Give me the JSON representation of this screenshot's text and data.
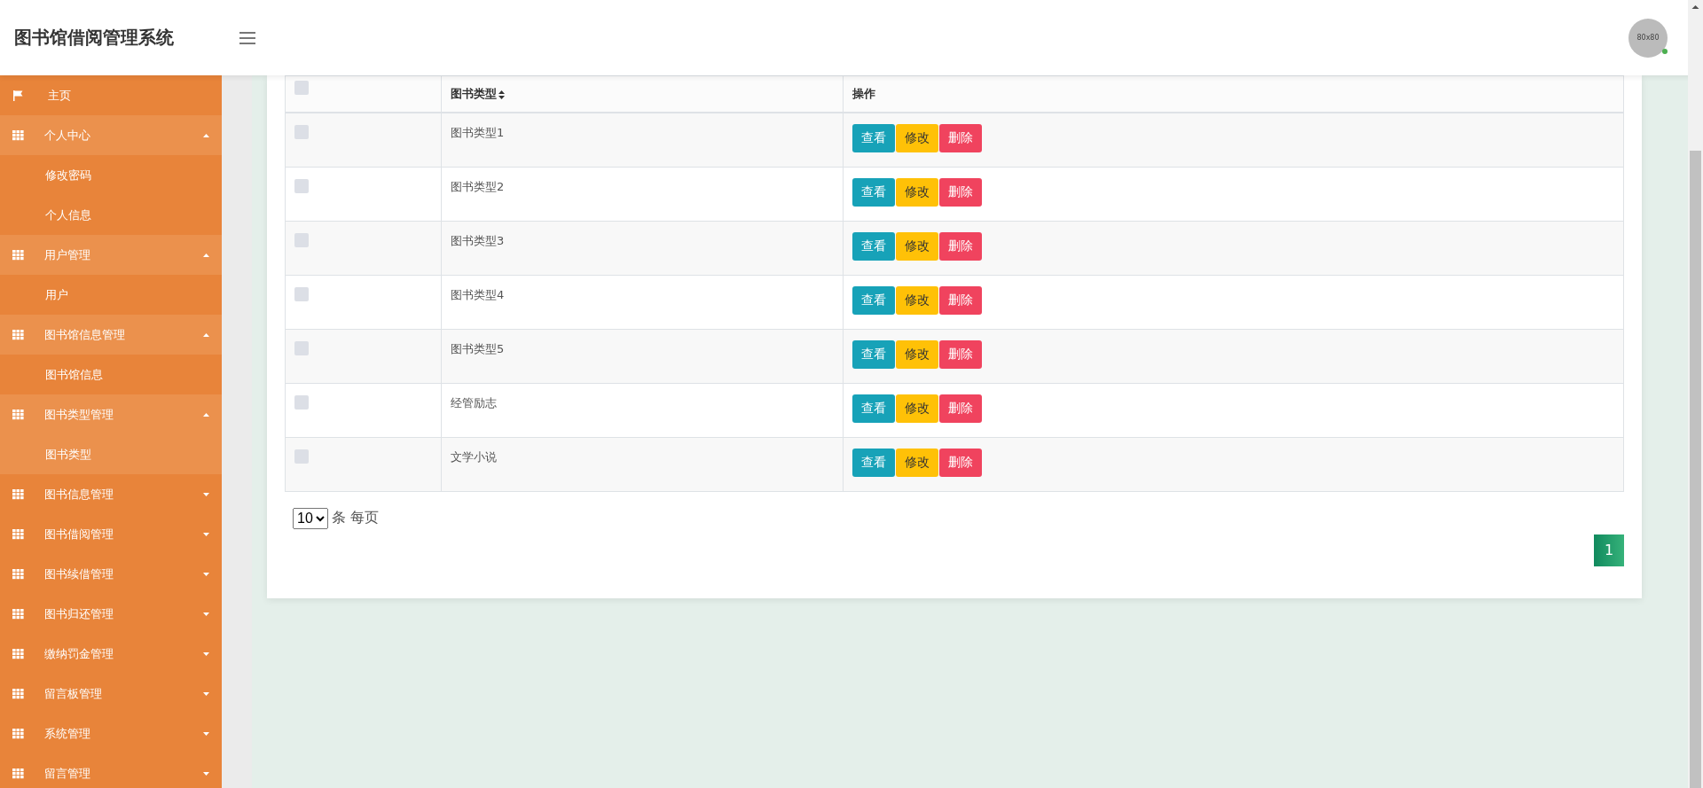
{
  "header": {
    "title": "图书馆借阅管理系统",
    "avatar_text": "80x80",
    "online": true
  },
  "sidebar": {
    "items": [
      {
        "label": "主页",
        "kind": "home"
      },
      {
        "label": "个人中心",
        "kind": "group",
        "expanded": true,
        "children": [
          {
            "label": "修改密码",
            "selected": false
          },
          {
            "label": "个人信息",
            "selected": false
          }
        ]
      },
      {
        "label": "用户管理",
        "kind": "group",
        "expanded": true,
        "children": [
          {
            "label": "用户",
            "selected": false
          }
        ]
      },
      {
        "label": "图书馆信息管理",
        "kind": "group",
        "expanded": true,
        "children": [
          {
            "label": "图书馆信息",
            "selected": false
          }
        ]
      },
      {
        "label": "图书类型管理",
        "kind": "group",
        "expanded": true,
        "children": [
          {
            "label": "图书类型",
            "selected": true
          }
        ]
      },
      {
        "label": "图书信息管理",
        "kind": "group",
        "expanded": false
      },
      {
        "label": "图书借阅管理",
        "kind": "group",
        "expanded": false
      },
      {
        "label": "图书续借管理",
        "kind": "group",
        "expanded": false
      },
      {
        "label": "图书归还管理",
        "kind": "group",
        "expanded": false
      },
      {
        "label": "缴纳罚金管理",
        "kind": "group",
        "expanded": false
      },
      {
        "label": "留言板管理",
        "kind": "group",
        "expanded": false
      },
      {
        "label": "系统管理",
        "kind": "group",
        "expanded": false
      },
      {
        "label": "留言管理",
        "kind": "group",
        "expanded": false
      }
    ]
  },
  "table": {
    "header_checked": false,
    "columns": [
      {
        "label": "图书类型",
        "sortable": true
      },
      {
        "label": "操作",
        "sortable": false
      }
    ],
    "rows": [
      {
        "checked": false,
        "type": "图书类型1",
        "actions": [
          {
            "label": "查看",
            "kind": "view"
          },
          {
            "label": "修改",
            "kind": "edit"
          },
          {
            "label": "删除",
            "kind": "delete"
          }
        ]
      },
      {
        "checked": false,
        "type": "图书类型2",
        "actions": [
          {
            "label": "查看",
            "kind": "view"
          },
          {
            "label": "修改",
            "kind": "edit"
          },
          {
            "label": "删除",
            "kind": "delete"
          }
        ]
      },
      {
        "checked": false,
        "type": "图书类型3",
        "actions": [
          {
            "label": "查看",
            "kind": "view"
          },
          {
            "label": "修改",
            "kind": "edit"
          },
          {
            "label": "删除",
            "kind": "delete"
          }
        ]
      },
      {
        "checked": false,
        "type": "图书类型4",
        "actions": [
          {
            "label": "查看",
            "kind": "view"
          },
          {
            "label": "修改",
            "kind": "edit"
          },
          {
            "label": "删除",
            "kind": "delete"
          }
        ]
      },
      {
        "checked": false,
        "type": "图书类型5",
        "actions": [
          {
            "label": "查看",
            "kind": "view"
          },
          {
            "label": "修改",
            "kind": "edit"
          },
          {
            "label": "删除",
            "kind": "delete"
          }
        ]
      },
      {
        "checked": false,
        "type": "经管励志",
        "actions": [
          {
            "label": "查看",
            "kind": "view"
          },
          {
            "label": "修改",
            "kind": "edit"
          },
          {
            "label": "删除",
            "kind": "delete"
          }
        ]
      },
      {
        "checked": false,
        "type": "文学小说",
        "actions": [
          {
            "label": "查看",
            "kind": "view"
          },
          {
            "label": "修改",
            "kind": "edit"
          },
          {
            "label": "删除",
            "kind": "delete"
          }
        ]
      }
    ]
  },
  "pagination": {
    "page_size": "10",
    "per_page_text": "条 每页",
    "pages": [
      {
        "label": "1",
        "selected": true
      }
    ]
  }
}
